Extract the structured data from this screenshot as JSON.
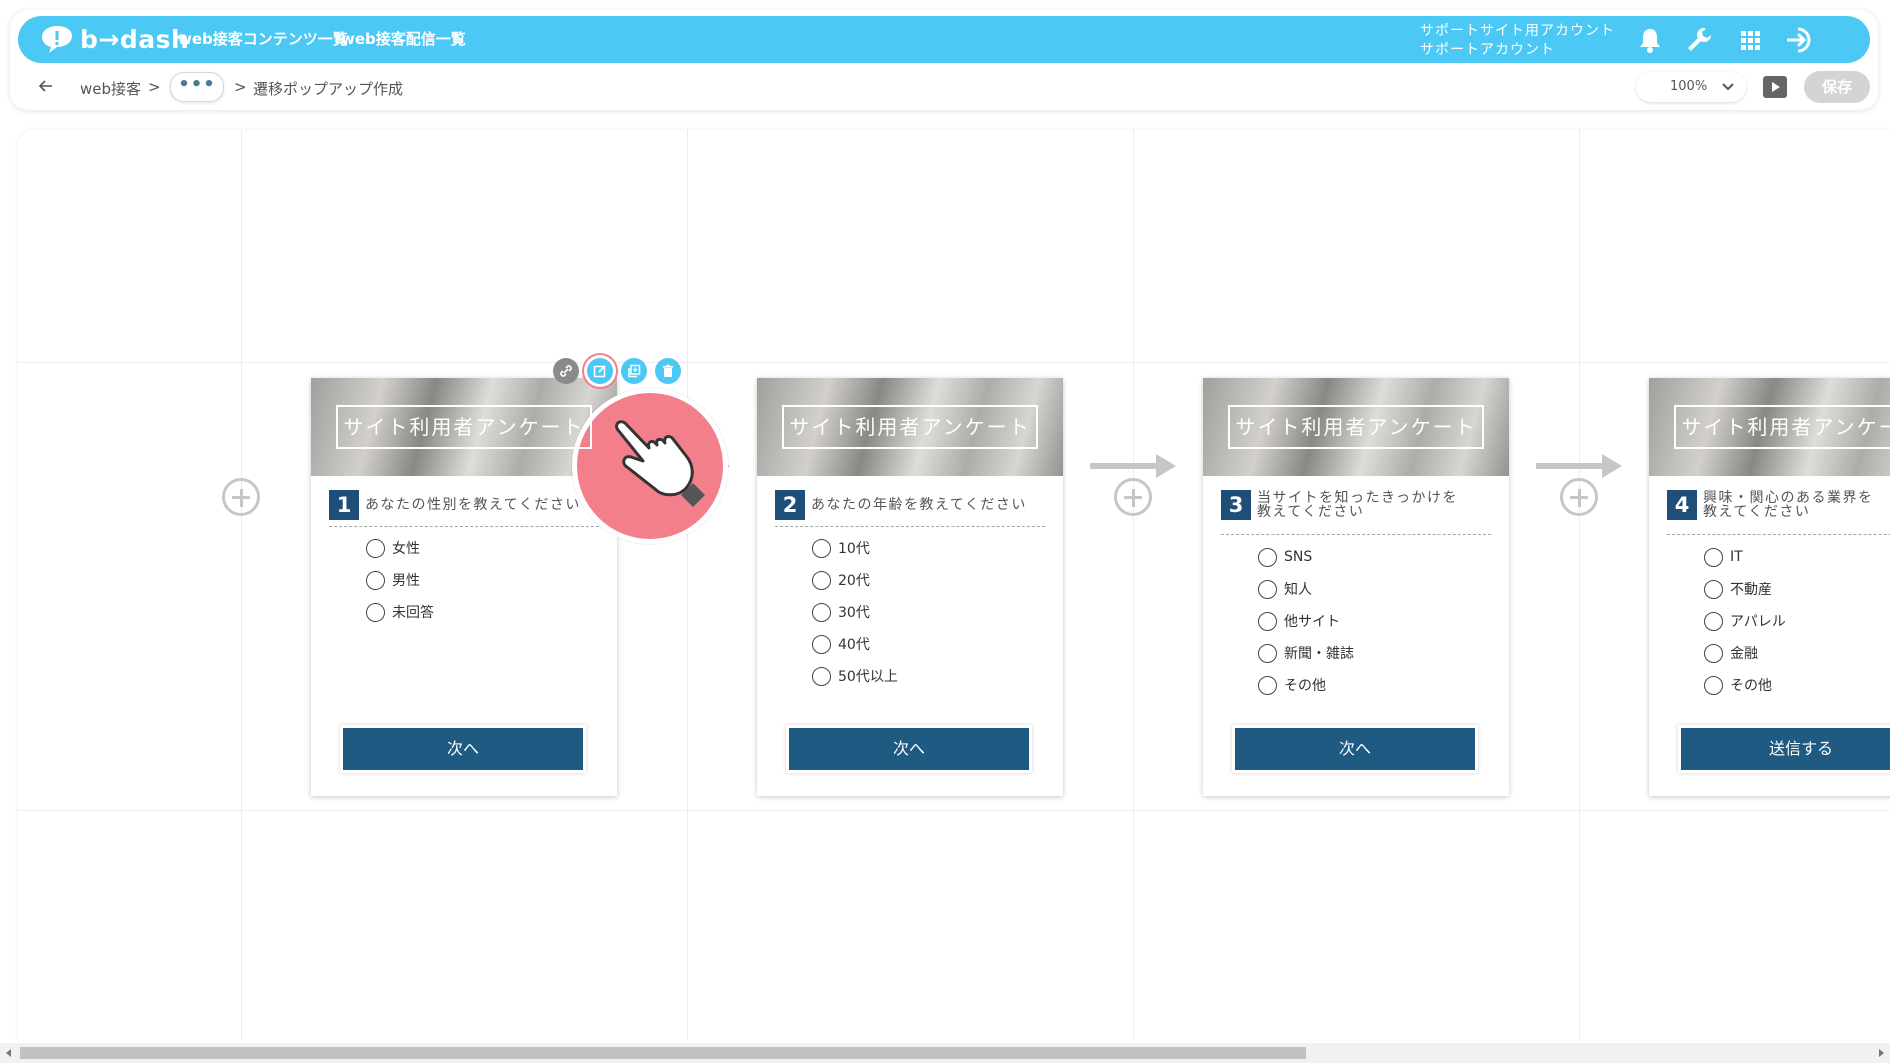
{
  "header": {
    "brand": "b→dash",
    "nav": [
      "web接客コンテンツ一覧",
      "web接客配信一覧"
    ],
    "account_line1": "サポートサイト用アカウント",
    "account_line2": "サポートアカウント",
    "icons": [
      "bell-icon",
      "wrench-icon",
      "grid-icon",
      "logout-icon"
    ]
  },
  "breadcrumb": {
    "back_icon": "back-arrow-icon",
    "root": "web接客",
    "sep1": ">",
    "more": "•••",
    "sep2": ">",
    "current": "遷移ポップアップ作成"
  },
  "toolbar": {
    "zoom": "100%",
    "play_icon": "play-icon",
    "save_label": "保存"
  },
  "card_toolbar_icons": [
    "link-icon",
    "edit-icon",
    "copy-icon",
    "trash-icon"
  ],
  "cards": [
    {
      "title": "サイト利用者アンケート",
      "number": "1",
      "question": "あなたの性別を教えてください",
      "options": [
        "女性",
        "男性",
        "未回答"
      ],
      "button": "次へ"
    },
    {
      "title": "サイト利用者アンケート",
      "number": "2",
      "question": "あなたの年齢を教えてください",
      "options": [
        "10代",
        "20代",
        "30代",
        "40代",
        "50代以上"
      ],
      "button": "次へ"
    },
    {
      "title": "サイト利用者アンケート",
      "number": "3",
      "question_line1": "当サイトを知ったきっかけを",
      "question_line2": "教えてください",
      "options": [
        "SNS",
        "知人",
        "他サイト",
        "新聞・雑誌",
        "その他"
      ],
      "button": "次へ"
    },
    {
      "title": "サイト利用者アンケート",
      "number": "4",
      "question_line1": "興味・関心のある業界を",
      "question_line2": "教えてください",
      "options": [
        "IT",
        "不動産",
        "アパレル",
        "金融",
        "その他"
      ],
      "button": "送信する"
    }
  ],
  "colors": {
    "header_bg": "#4cc8f4",
    "card_number_bg": "#1f4e79",
    "button_bg": "#1f5a82",
    "pointer": "#f37f8a",
    "save_disabled": "#d4d4d4"
  }
}
